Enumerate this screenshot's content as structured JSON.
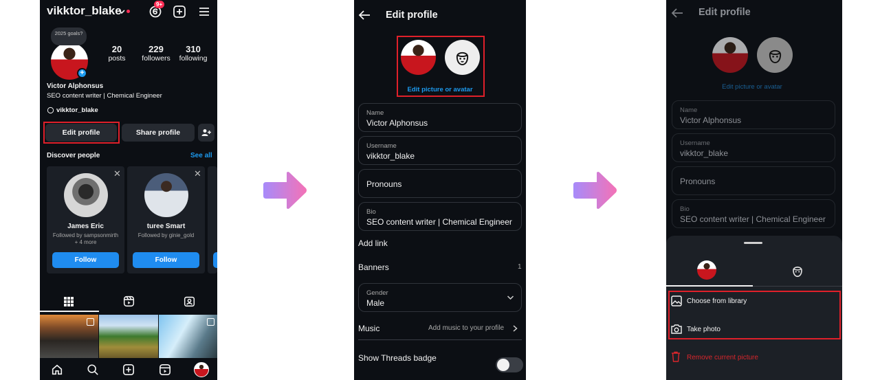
{
  "colors": {
    "highlight": "#e0202a",
    "accent_blue": "#1d9bf0",
    "follow_blue": "#1f8cf0",
    "danger": "#d9262c",
    "arrow_gradient": [
      "#a78bfa",
      "#f472b6"
    ]
  },
  "profile_screen": {
    "username": "vikktor_blake",
    "notification_badge": "9+",
    "note_bubble": "2025 goals?",
    "stats": [
      {
        "value": "20",
        "label": "posts"
      },
      {
        "value": "229",
        "label": "followers"
      },
      {
        "value": "310",
        "label": "following"
      }
    ],
    "full_name": "Victor Alphonsus",
    "bio": "SEO content writer | Chemical Engineer",
    "threads_handle": "vikktor_blake",
    "edit_profile_label": "Edit profile",
    "share_profile_label": "Share profile",
    "discover_title": "Discover people",
    "see_all": "See all",
    "suggestions": [
      {
        "name": "James Eric",
        "sub": "Followed by sampsonmirth + 4 more",
        "follow": "Follow"
      },
      {
        "name": "turee Smart",
        "sub": "Followed by ginie_gold",
        "follow": "Follow"
      }
    ],
    "tab_icons": [
      "grid-icon",
      "reels-icon",
      "tagged-icon"
    ],
    "nav_icons": [
      "home-icon",
      "search-icon",
      "create-icon",
      "reels-icon",
      "profile-avatar"
    ]
  },
  "edit_screen": {
    "title": "Edit profile",
    "edit_picture_label": "Edit picture or avatar",
    "fields": [
      {
        "label": "Name",
        "value": "Victor Alphonsus"
      },
      {
        "label": "Username",
        "value": "vikktor_blake"
      },
      {
        "label": "",
        "value": "Pronouns"
      },
      {
        "label": "Bio",
        "value": "SEO content writer | Chemical Engineer"
      }
    ],
    "add_link": "Add link",
    "banners": "Banners",
    "banners_count": "1",
    "gender_label": "Gender",
    "gender_value": "Male",
    "music_label": "Music",
    "music_hint": "Add music to your profile",
    "threads_badge": "Show Threads badge"
  },
  "picker_sheet": {
    "choose_library": "Choose from library",
    "take_photo": "Take photo",
    "remove_picture": "Remove current picture"
  }
}
